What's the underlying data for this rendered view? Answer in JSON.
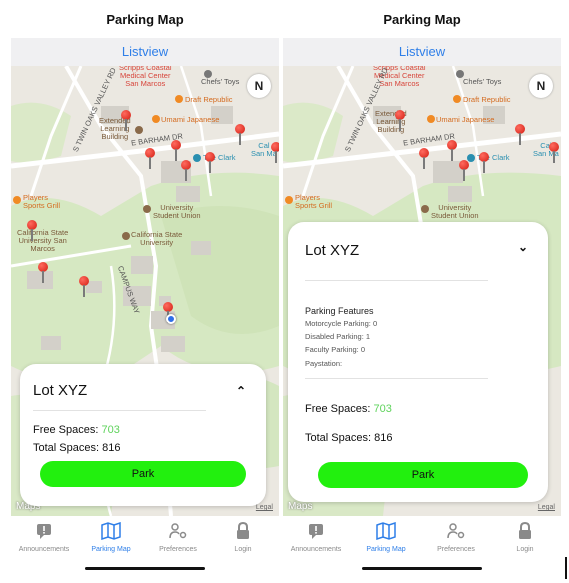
{
  "screens": {
    "left": {
      "title": "Parking Map",
      "listview_label": "Listview",
      "compass_label": "N",
      "map": {
        "labels": {
          "scripps": "Scripps Coastal\nMedical Center\nSan Marcos",
          "chefs": "Chefs' Toys",
          "draft": "Draft Republic",
          "umami": "Umami Japanese",
          "extended": "Extended\nLearning\nBuilding",
          "clark": "The Clark",
          "players": "Players\nSports Grill",
          "union": "University\nStudent Union",
          "csu": "California State\nUniversity",
          "csusm": "California State\nUniversity San\nMarcos",
          "barham": "E BARHAM DR",
          "twin_oaks": "S TWIN OAKS VALLEY RD",
          "campus_way": "CAMPUS WAY",
          "cal": "Cal\nSan Ma"
        },
        "maps_logo": "Maps",
        "legal": "Legal"
      },
      "card": {
        "title": "Lot XYZ",
        "chevron": "⌃",
        "free_label": "Free Spaces:",
        "free_value": "703",
        "total_label": "Total Spaces:",
        "total_value": "816",
        "park_label": "Park"
      }
    },
    "right": {
      "title": "Parking Map",
      "listview_label": "Listview",
      "compass_label": "N",
      "map": {
        "labels": {
          "scripps": "Scripps Coastal\nMedical Center\nSan Marcos",
          "chefs": "Chefs' Toys",
          "draft": "Draft Republic",
          "umami": "Umami Japanese",
          "extended": "Extended\nLearning\nBuilding",
          "clark": "The Clark",
          "players": "Players\nSports Grill",
          "union": "University\nStudent Union",
          "barham": "E BARHAM DR",
          "twin_oaks": "S TWIN OAKS VALLEY RD",
          "cal": "Cal\nSan Ma"
        },
        "maps_logo": "Maps",
        "legal": "Legal"
      },
      "card": {
        "title": "Lot XYZ",
        "chevron": "⌄",
        "features_heading": "Parking Features",
        "motorcycle": "Motorcycle Parking: 0",
        "disabled": "Disabled Parking: 1",
        "faculty": "Faculty Parking: 0",
        "paystation": "Paystation:",
        "free_label": "Free Spaces:",
        "free_value": "703",
        "total_label": "Total Spaces:",
        "total_value": "816",
        "park_label": "Park"
      }
    }
  },
  "tabs": [
    {
      "label": "Announcements",
      "icon": "announcement-icon",
      "active": false
    },
    {
      "label": "Parking Map",
      "icon": "map-icon",
      "active": true
    },
    {
      "label": "Preferences",
      "icon": "preferences-icon",
      "active": false
    },
    {
      "label": "Login",
      "icon": "lock-icon",
      "active": false
    }
  ],
  "colors": {
    "accent": "#2f7fe8",
    "park_button": "#22f00e",
    "free_value": "#5fd35c",
    "pin": "#d21d12"
  }
}
